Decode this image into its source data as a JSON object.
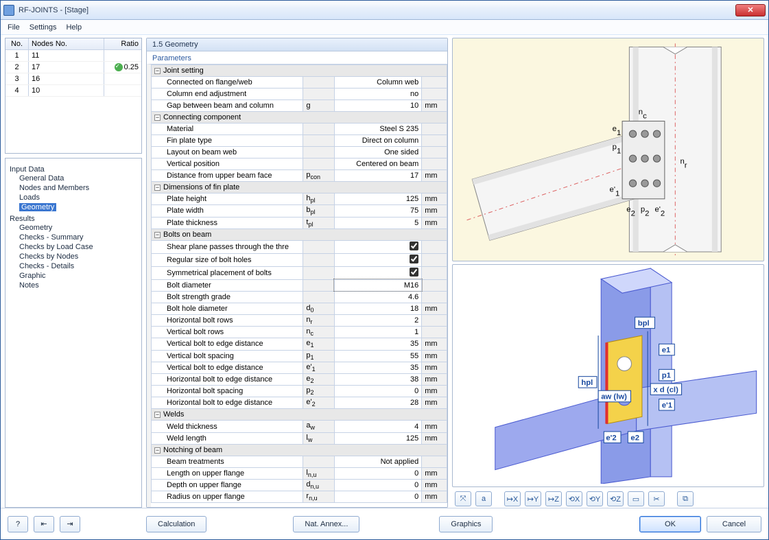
{
  "title": "RF-JOINTS - [Stage]",
  "menu": [
    "File",
    "Settings",
    "Help"
  ],
  "nodes_table": {
    "headers": [
      "No.",
      "Nodes No.",
      "Ratio"
    ],
    "rows": [
      {
        "no": "1",
        "nodes": "11",
        "ratio": ""
      },
      {
        "no": "2",
        "nodes": "17",
        "ratio": "0.25",
        "ok": true
      },
      {
        "no": "3",
        "nodes": "16",
        "ratio": ""
      },
      {
        "no": "4",
        "nodes": "10",
        "ratio": ""
      }
    ]
  },
  "tree": {
    "input_hdr": "Input Data",
    "input_items": [
      "General Data",
      "Nodes and Members",
      "Loads",
      "Geometry"
    ],
    "results_hdr": "Results",
    "results_items": [
      "Geometry",
      "Checks - Summary",
      "Checks by Load Case",
      "Checks by Nodes",
      "Checks - Details",
      "Graphic",
      "Notes"
    ]
  },
  "section_title": "1.5 Geometry",
  "param_label": "Parameters",
  "groups": {
    "joint": "Joint setting",
    "conn": "Connecting component",
    "dim": "Dimensions of fin plate",
    "bolts": "Bolts on beam",
    "welds": "Welds",
    "notch": "Notching of beam"
  },
  "rows": {
    "j1": {
      "n": "Connected on flange/web",
      "s": "",
      "v": "Column web",
      "u": ""
    },
    "j2": {
      "n": "Column end adjustment",
      "s": "",
      "v": "no",
      "u": ""
    },
    "j3": {
      "n": "Gap between beam and column",
      "s": "g",
      "v": "10",
      "u": "mm"
    },
    "c1": {
      "n": "Material",
      "s": "",
      "v": "Steel S 235",
      "u": ""
    },
    "c2": {
      "n": "Fin plate type",
      "s": "",
      "v": "Direct on column",
      "u": ""
    },
    "c3": {
      "n": "Layout on beam web",
      "s": "",
      "v": "One sided",
      "u": ""
    },
    "c4": {
      "n": "Vertical position",
      "s": "",
      "v": "Centered on beam",
      "u": ""
    },
    "c5": {
      "n": "Distance from upper beam face",
      "s": "p con",
      "v": "17",
      "u": "mm"
    },
    "d1": {
      "n": "Plate height",
      "s": "h pl",
      "v": "125",
      "u": "mm"
    },
    "d2": {
      "n": "Plate width",
      "s": "b pl",
      "v": "75",
      "u": "mm"
    },
    "d3": {
      "n": "Plate thickness",
      "s": "t pl",
      "v": "5",
      "u": "mm"
    },
    "b1": {
      "n": "Shear plane passes through the thre",
      "chk": true
    },
    "b2": {
      "n": "Regular size of bolt holes",
      "chk": true
    },
    "b3": {
      "n": "Symmetrical placement of bolts",
      "chk": true
    },
    "b4": {
      "n": "Bolt diameter",
      "s": "",
      "v": "M16",
      "u": ""
    },
    "b5": {
      "n": "Bolt strength grade",
      "s": "",
      "v": "4.6",
      "u": ""
    },
    "b6": {
      "n": "Bolt hole diameter",
      "s": "d 0",
      "v": "18",
      "u": "mm"
    },
    "b7": {
      "n": "Horizontal bolt rows",
      "s": "n r",
      "v": "2",
      "u": ""
    },
    "b8": {
      "n": "Vertical bolt rows",
      "s": "n c",
      "v": "1",
      "u": ""
    },
    "b9": {
      "n": "Vertical bolt to edge distance",
      "s": "e 1",
      "v": "35",
      "u": "mm"
    },
    "b10": {
      "n": "Vertical bolt spacing",
      "s": "p 1",
      "v": "55",
      "u": "mm"
    },
    "b11": {
      "n": "Vertical bolt to edge distance",
      "s": "e' 1",
      "v": "35",
      "u": "mm"
    },
    "b12": {
      "n": "Horizontal bolt to edge distance",
      "s": "e 2",
      "v": "38",
      "u": "mm"
    },
    "b13": {
      "n": "Horizontal bolt spacing",
      "s": "p 2",
      "v": "0",
      "u": "mm"
    },
    "b14": {
      "n": "Horizontal bolt to edge distance",
      "s": "e' 2",
      "v": "28",
      "u": "mm"
    },
    "w1": {
      "n": "Weld thickness",
      "s": "a w",
      "v": "4",
      "u": "mm"
    },
    "w2": {
      "n": "Weld length",
      "s": "l w",
      "v": "125",
      "u": "mm"
    },
    "n1": {
      "n": "Beam treatments",
      "s": "",
      "v": "Not applied",
      "u": ""
    },
    "n2": {
      "n": "Length on upper flange",
      "s": "l n,u",
      "v": "0",
      "u": "mm"
    },
    "n3": {
      "n": "Depth on upper flange",
      "s": "d n,u",
      "v": "0",
      "u": "mm"
    },
    "n4": {
      "n": "Radius on upper flange",
      "s": "r n,u",
      "v": "0",
      "u": "mm"
    }
  },
  "diagram_labels": {
    "nc": "n c",
    "nr": "n r",
    "e1": "e 1",
    "p1": "p 1",
    "e1p": "e' 1",
    "e2": "e 2",
    "p2": "p 2",
    "e2p": "e' 2",
    "bpl": "bpl",
    "hpl": "hpl",
    "aw": "aw (lw)",
    "xd": "x d (cl)"
  },
  "toolbar_icons": [
    "xyz-icon",
    "text-icon",
    "axes-x-icon",
    "axes-y-icon",
    "axes-z-icon",
    "rot-x-icon",
    "rot-y-icon",
    "rot-z-icon",
    "box-icon",
    "clip-icon",
    "copy-icon"
  ],
  "footer": {
    "help": "?",
    "calc": "Calculation",
    "annex": "Nat. Annex...",
    "graphics": "Graphics",
    "ok": "OK",
    "cancel": "Cancel"
  }
}
